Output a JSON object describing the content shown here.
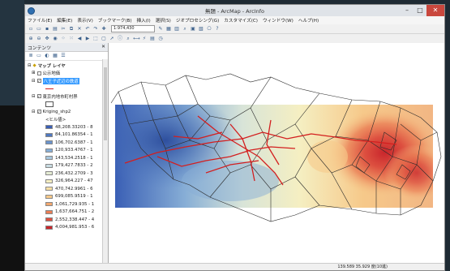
{
  "window": {
    "title": "無題 - ArcMap - ArcInfo",
    "controls": [
      "–",
      "□",
      "✕"
    ]
  },
  "menu": [
    "ファイル(E)",
    "編集(E)",
    "表示(V)",
    "ブックマーク(B)",
    "挿入(I)",
    "選択(S)",
    "ジオプロセシング(G)",
    "カスタマイズ(C)",
    "ウィンドウ(W)",
    "ヘルプ(H)"
  ],
  "toolbar": {
    "scale": "1:974,430"
  },
  "toc": {
    "title": "コンテンツ",
    "controls": "✕",
    "root": "マップ レイヤ",
    "layers": [
      {
        "label": "公示地価",
        "checked": false
      },
      {
        "label": "八王子近辺の鉄道",
        "checked": true,
        "selected": true
      },
      {
        "label": "東京内地市町村界",
        "checked": true
      },
      {
        "label": "Kriging_shp2",
        "checked": true
      }
    ],
    "legend_header": "<ヒル値>",
    "legend": [
      {
        "label": "48,208.33203 - 8",
        "color": "#3a5fb5"
      },
      {
        "label": "84,101.86354 - 1",
        "color": "#4f78c0"
      },
      {
        "label": "106,702.6387 - 1",
        "color": "#6a93cc"
      },
      {
        "label": "120,933.4767 - 1",
        "color": "#87aed6"
      },
      {
        "label": "143,534.2518 - 1",
        "color": "#a7c6de"
      },
      {
        "label": "179,427.7833 - 2",
        "color": "#c8dce2"
      },
      {
        "label": "236,432.2709 - 3",
        "color": "#e4ecd3"
      },
      {
        "label": "326,964.227 - 47",
        "color": "#f5efc2"
      },
      {
        "label": "470,742.9961 - 6",
        "color": "#f7dfa5"
      },
      {
        "label": "699,085.9519 - 1",
        "color": "#f6c98a"
      },
      {
        "label": "1,061,729.935 - 1",
        "color": "#f2a76e"
      },
      {
        "label": "1,637,664.751 - 2",
        "color": "#ea7e55"
      },
      {
        "label": "2,552,338.447 - 4",
        "color": "#dd5040"
      },
      {
        "label": "4,004,981.953 - 6",
        "color": "#c9262c"
      }
    ]
  },
  "status": {
    "coords": "139.589 35.929 度(10進)"
  },
  "colors": {
    "rail": "#d31f1f",
    "close_button": "#c9473d",
    "selection": "#3399ff"
  }
}
